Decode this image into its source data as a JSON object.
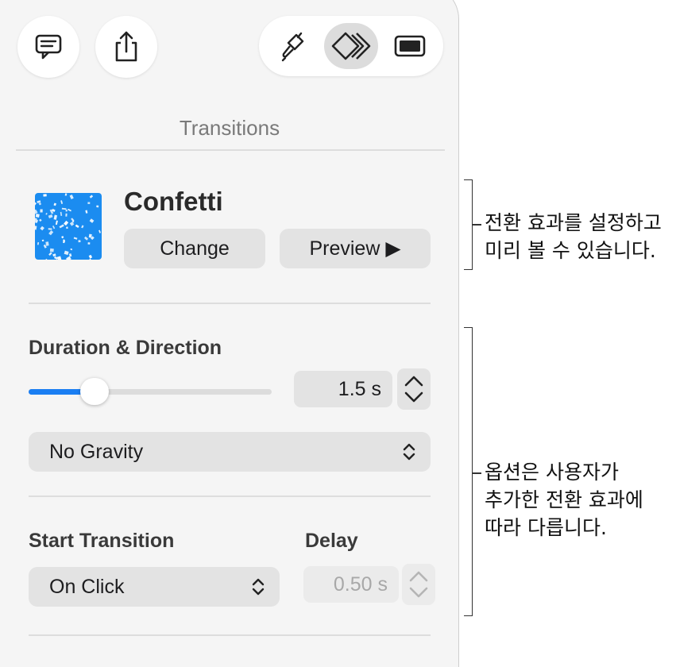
{
  "toolbar": {
    "comment_icon": "comment-icon",
    "share_icon": "share-icon",
    "format_icon": "paintbrush-icon",
    "animate_icon": "animate-diamond-icon",
    "document_icon": "document-icon"
  },
  "panel": {
    "title": "Transitions"
  },
  "transition": {
    "name": "Confetti",
    "change_label": "Change",
    "preview_label": "Preview ▶"
  },
  "duration": {
    "label": "Duration & Direction",
    "value": "1.5 s",
    "slider_fraction": 0.27,
    "direction": "No Gravity"
  },
  "start": {
    "label": "Start Transition",
    "value": "On Click",
    "delay_label": "Delay",
    "delay_value": "0.50 s"
  },
  "callouts": {
    "top_line1": "전환 효과를 설정하고",
    "top_line2": "미리 볼 수 있습니다.",
    "bottom_line1": "옵션은 사용자가",
    "bottom_line2": "추가한 전환 효과에",
    "bottom_line3": "따라 다릅니다."
  },
  "colors": {
    "accent": "#1a7ef2",
    "panel_bg": "#f5f5f5",
    "control_bg": "#e3e3e3"
  }
}
